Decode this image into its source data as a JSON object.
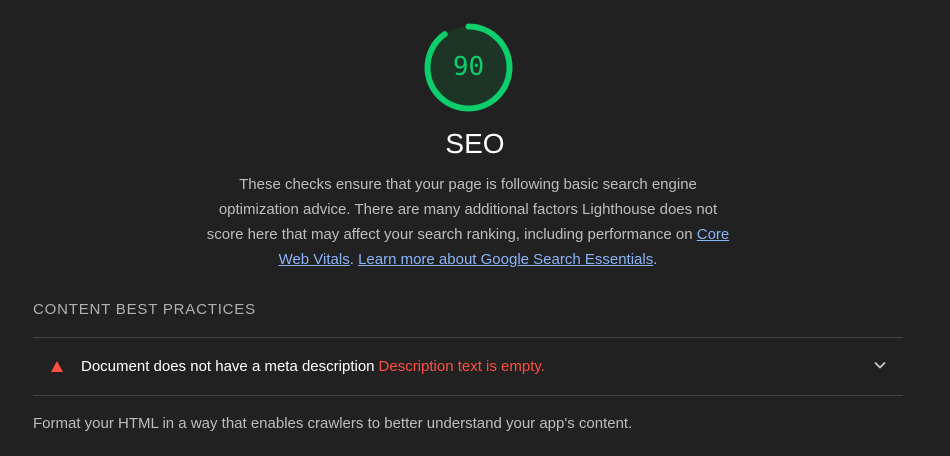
{
  "gauge": {
    "score": "90",
    "score_fraction": 0.9,
    "color": "#0cce6b"
  },
  "category": {
    "title": "SEO",
    "description_prefix": "These checks ensure that your page is following basic search engine optimization advice. There are many additional factors Lighthouse does not score here that may affect your search ranking, including performance on",
    "link_core_web_vitals": "Core Web Vitals",
    "separator": ".",
    "link_learn_more": "Learn more about Google Search Essentials",
    "suffix": "."
  },
  "section": {
    "heading": "CONTENT BEST PRACTICES"
  },
  "audit": {
    "icon": "warning-triangle-icon",
    "title": "Document does not have a meta description",
    "detail": "Description text is empty.",
    "fail_color": "#ff4e42"
  },
  "footer": {
    "text": "Format your HTML in a way that enables crawlers to better understand your app's content."
  }
}
